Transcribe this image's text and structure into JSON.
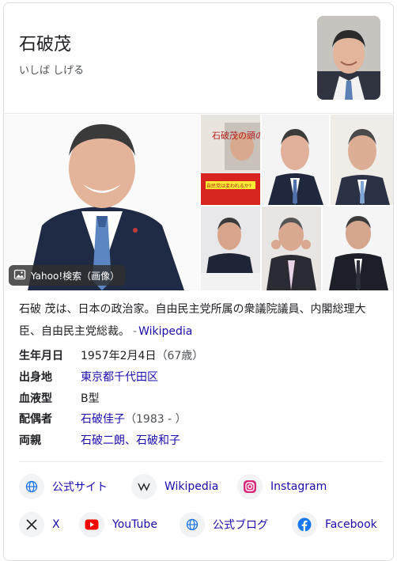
{
  "header": {
    "title": "石破茂",
    "reading": "いしば しげる"
  },
  "images": {
    "source_badge": "Yahoo!検索（画像）",
    "book_cover_title": "石破茂の頭の中",
    "book_cover_banner": "自民党は変われるか?"
  },
  "description": {
    "text": "石破 茂は、日本の政治家。自由民主党所属の衆議院議員、内閣総理大臣、自由民主党総裁。",
    "dash": "-",
    "source": "Wikipedia"
  },
  "facts": [
    {
      "key": "生年月日",
      "value": "1957年2月4日",
      "extra": "（67歳）"
    },
    {
      "key": "出身地",
      "value": "東京都千代田区",
      "extra": ""
    },
    {
      "key": "血液型",
      "value": "B型",
      "extra": ""
    },
    {
      "key": "配偶者",
      "value": "石破佳子",
      "extra": "（1983 - ）"
    },
    {
      "key": "両親",
      "value": "石破二朗、石破和子",
      "extra": ""
    }
  ],
  "profiles": [
    {
      "label": "公式サイト",
      "icon": "globe-icon"
    },
    {
      "label": "Wikipedia",
      "icon": "wikipedia-icon"
    },
    {
      "label": "Instagram",
      "icon": "instagram-icon"
    },
    {
      "label": "X",
      "icon": "x-icon"
    },
    {
      "label": "YouTube",
      "icon": "youtube-icon"
    },
    {
      "label": "公式ブログ",
      "icon": "globe-icon"
    },
    {
      "label": "Facebook",
      "icon": "facebook-icon"
    }
  ],
  "colors": {
    "link": "#1a0dab",
    "text": "#202124",
    "muted": "#4d5156",
    "border": "#dadce0"
  }
}
